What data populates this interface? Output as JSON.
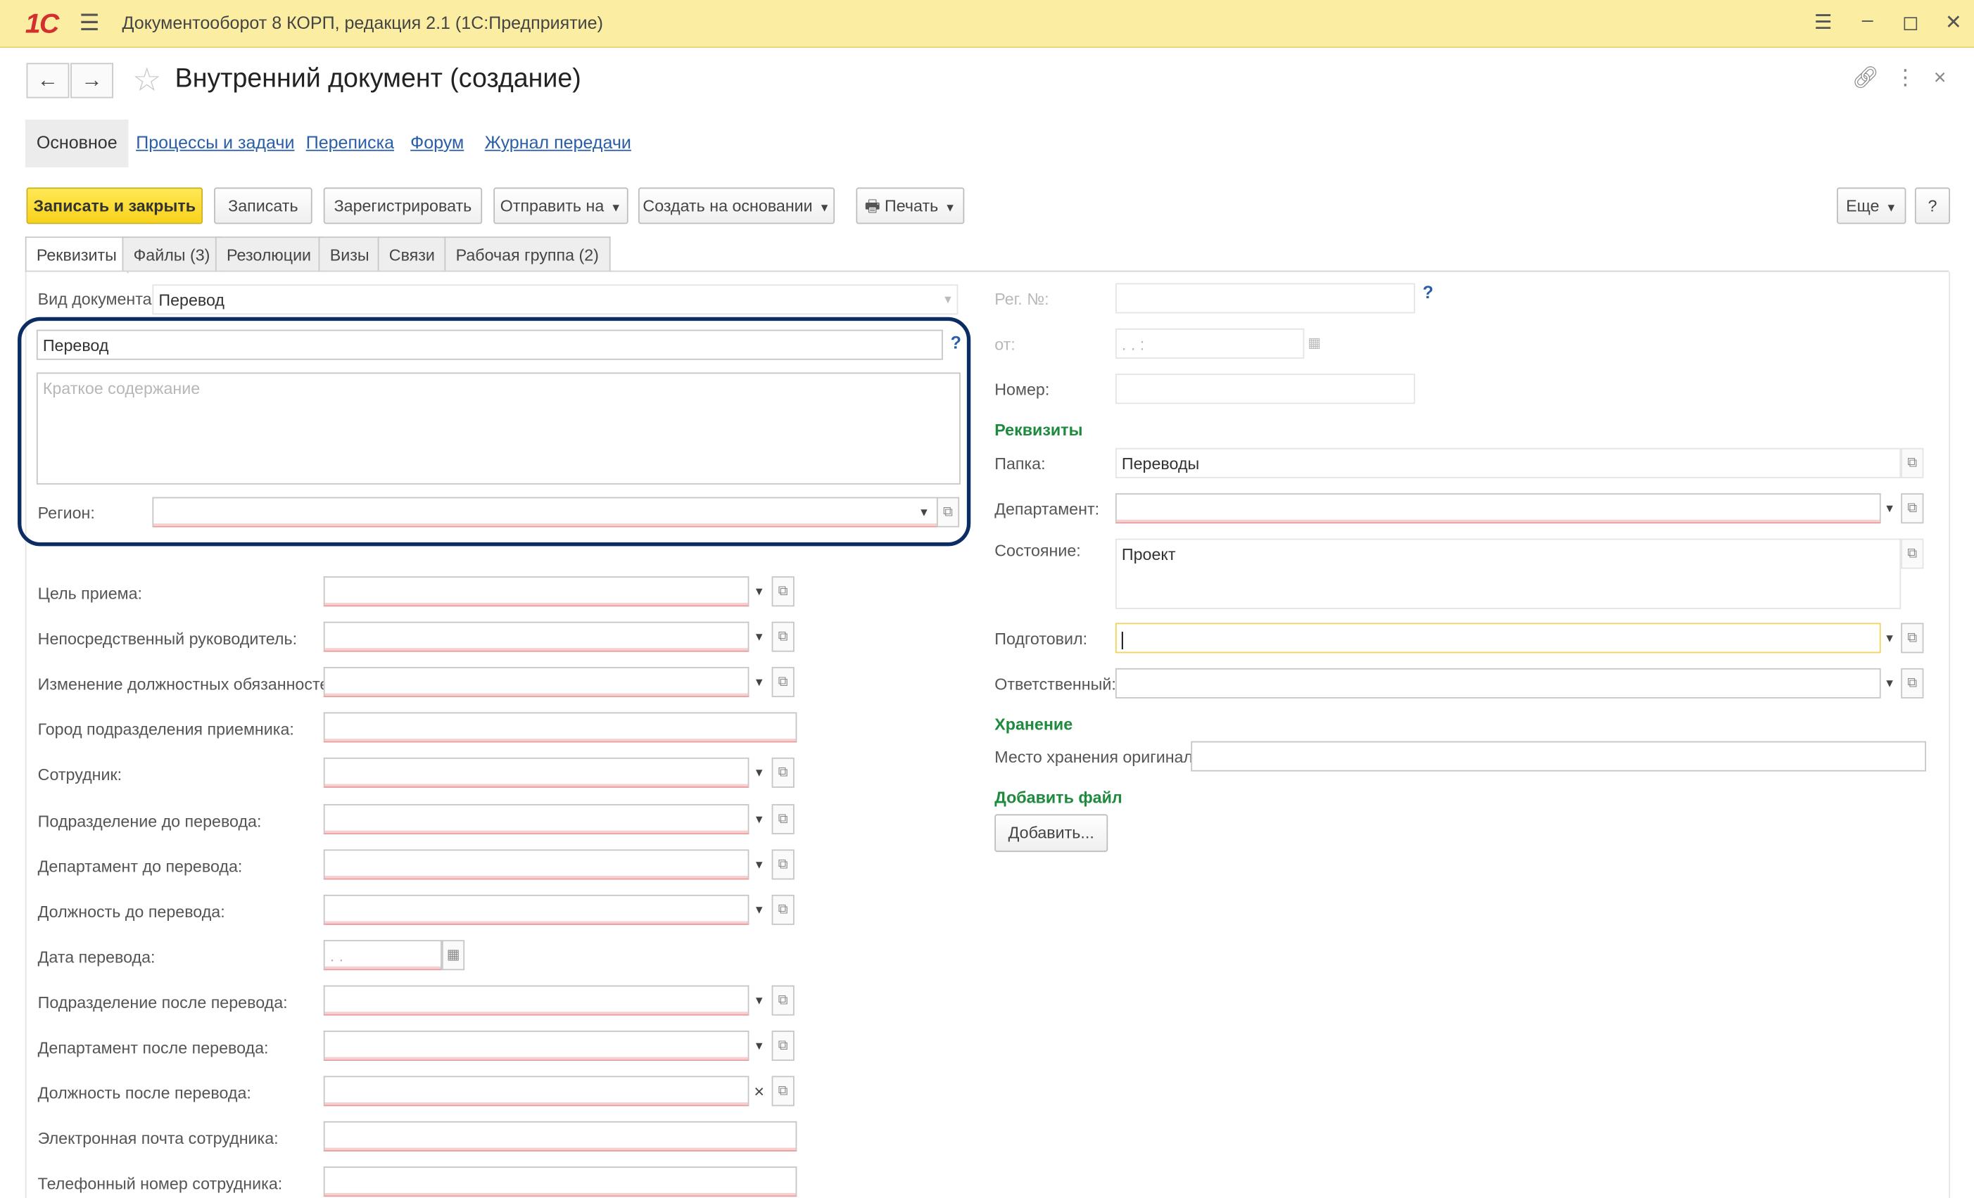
{
  "titlebar": {
    "logo": "1С",
    "title": "Документооборот 8 КОРП, редакция 2.1  (1С:Предприятие)"
  },
  "form": {
    "title": "Внутренний документ (создание)"
  },
  "nav_links": [
    "Основное",
    "Процессы и задачи",
    "Переписка",
    "Форум",
    "Журнал передачи"
  ],
  "commands": {
    "save_close": "Записать и закрыть",
    "save": "Записать",
    "register": "Зарегистрировать",
    "send": "Отправить на",
    "create_based": "Создать на основании",
    "print": "Печать",
    "more": "Еще",
    "help": "?"
  },
  "tabs": [
    "Реквизиты",
    "Файлы (3)",
    "Резолюции",
    "Визы",
    "Связи",
    "Рабочая группа (2)"
  ],
  "left": {
    "doc_type_label": "Вид документа:",
    "doc_type_value": "Перевод",
    "title_value": "Перевод",
    "help": "?",
    "summary_placeholder": "Краткое содержание",
    "region_label": "Регион:",
    "fields": [
      {
        "label": "Цель приема:",
        "value": ""
      },
      {
        "label": "Непосредственный руководитель:",
        "value": ""
      },
      {
        "label": "Изменение должностных обязанностей:",
        "value": ""
      },
      {
        "label": "Город подразделения приемника:",
        "value": ""
      },
      {
        "label": "Сотрудник:",
        "value": ""
      },
      {
        "label": "Подразделение до перевода:",
        "value": ""
      },
      {
        "label": "Департамент до перевода:",
        "value": ""
      },
      {
        "label": "Должность до перевода:",
        "value": ""
      },
      {
        "label": "Дата перевода:",
        "value": " .  . "
      },
      {
        "label": "Подразделение после перевода:",
        "value": ""
      },
      {
        "label": "Департамент после перевода:",
        "value": ""
      },
      {
        "label": "Должность после перевода:",
        "value": ""
      },
      {
        "label": "Электронная почта сотрудника:",
        "value": ""
      },
      {
        "label": "Телефонный номер сотрудника:",
        "value": ""
      }
    ]
  },
  "right": {
    "reg_no_label": "Рег. №:",
    "from_label": "от:",
    "date_placeholder": " .  .     :  ",
    "number_label": "Номер:",
    "section_requisites": "Реквизиты",
    "folder_label": "Папка:",
    "folder_value": "Переводы",
    "department_label": "Департамент:",
    "state_label": "Состояние:",
    "state_value": "Проект",
    "prepared_label": "Подготовил:",
    "responsible_label": "Ответственный:",
    "section_storage": "Хранение",
    "storage_label": "Место хранения оригинала:",
    "section_add_file": "Добавить файл",
    "add_button": "Добавить..."
  }
}
